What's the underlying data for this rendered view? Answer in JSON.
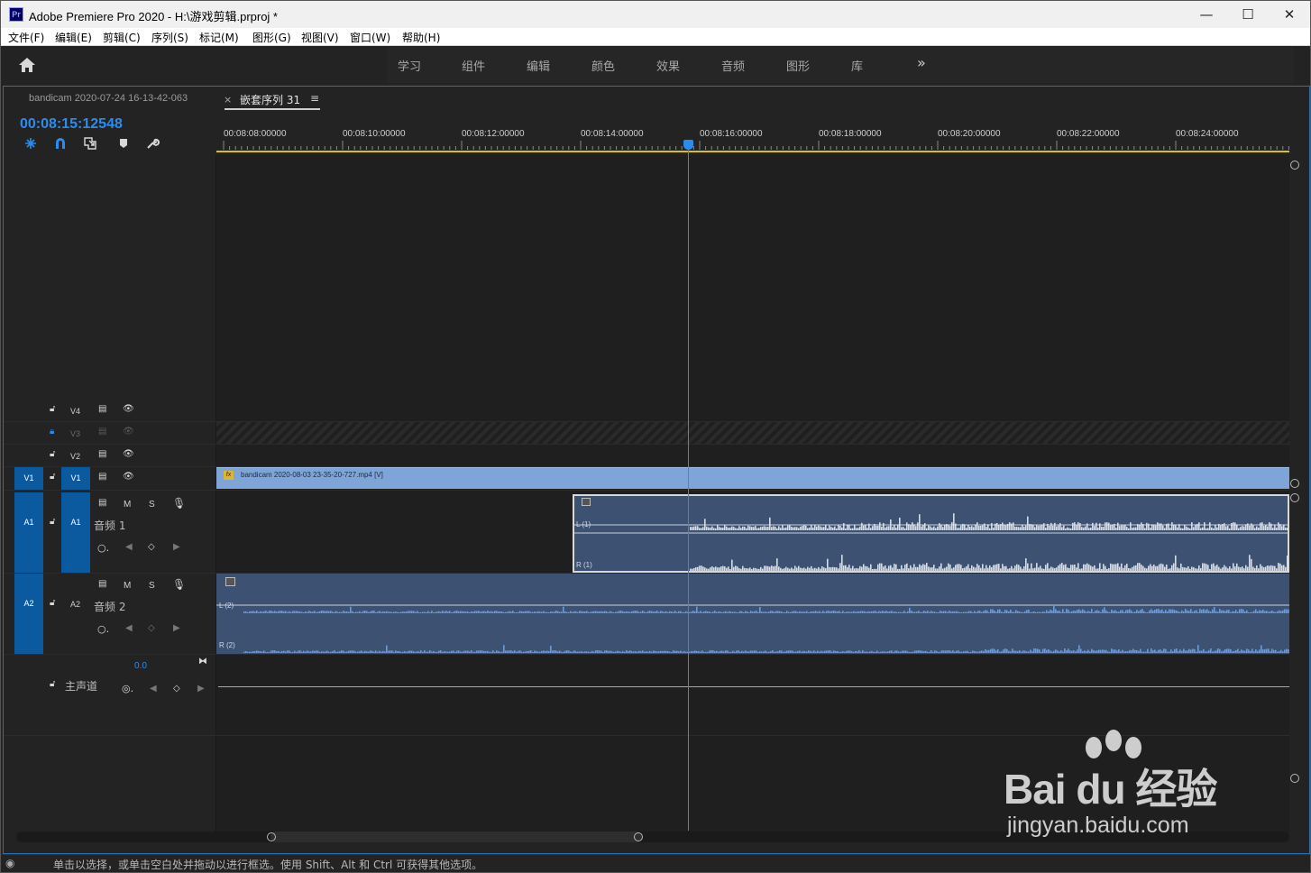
{
  "window": {
    "title": "Adobe Premiere Pro 2020 - H:\\游戏剪辑.prproj *",
    "app_icon_text": "Pr",
    "minimize": "—",
    "maximize": "☐",
    "close": "✕"
  },
  "menu": [
    "文件(F)",
    "编辑(E)",
    "剪辑(C)",
    "序列(S)",
    "标记(M)",
    "图形(G)",
    "视图(V)",
    "窗口(W)",
    "帮助(H)"
  ],
  "workspaces": [
    "学习",
    "组件",
    "编辑",
    "颜色",
    "效果",
    "音频",
    "图形",
    "库"
  ],
  "workspace_more": "»",
  "panel": {
    "source_tab": "bandicam 2020-07-24 16-13-42-063",
    "sequence_tab_close": "×",
    "sequence_tab": "嵌套序列 31",
    "sequence_tab_menu": "≡",
    "timecode": "00:08:15:12548"
  },
  "ruler_labels": [
    "00:08:08:00000",
    "00:08:10:00000",
    "00:08:12:00000",
    "00:08:14:00000",
    "00:08:16:00000",
    "00:08:18:00000",
    "00:08:20:00000",
    "00:08:22:00000",
    "00:08:24:00000"
  ],
  "tracks": {
    "v4": "V4",
    "v3": "V3",
    "v2": "V2",
    "v1_source": "V1",
    "v1": "V1",
    "a1_source": "A1",
    "a1": "A1",
    "a1_name": "音频 1",
    "a2_source": "A2",
    "a2": "A2",
    "a2_name": "音频 2",
    "mute": "M",
    "solo": "S",
    "master_name": "主声道",
    "master_value": "0.0"
  },
  "clips": {
    "video_fx": "fx",
    "video_name": "bandicam 2020-08-03 23-35-20-727.mp4 [V]",
    "a1_left": "L (1)",
    "a1_right": "R (1)",
    "a2_left": "L (2)",
    "a2_right": "R (2)"
  },
  "status": "单击以选择，或单击空白处并拖动以进行框选。使用 Shift、Alt 和 Ctrl 可获得其他选项。",
  "watermark": {
    "logo": "Bai du 经验",
    "url": "jingyan.baidu.com"
  },
  "colors": {
    "accent_blue": "#2d8ceb",
    "video_clip": "#7ea4d8",
    "audio_clip": "#3d5272",
    "source_patch": "#0b5aa0",
    "work_area": "#d4c314"
  }
}
